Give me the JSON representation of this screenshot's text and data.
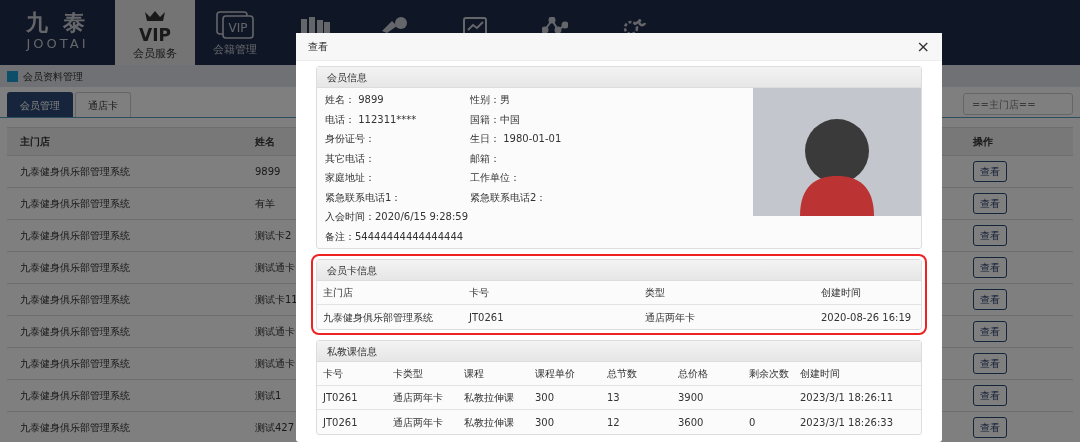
{
  "nav": {
    "logo_cn": "九 泰",
    "logo_en": "JOOTAI",
    "items": [
      {
        "kind": "crown",
        "icon_text": "VIP",
        "label": "会员服务",
        "selected": true
      },
      {
        "kind": "card",
        "icon_text": "VIP",
        "label": "会籍管理",
        "selected": false
      },
      {
        "kind": "books",
        "selected": false
      },
      {
        "kind": "tools",
        "selected": false
      },
      {
        "kind": "chart",
        "selected": false
      },
      {
        "kind": "network",
        "selected": false
      },
      {
        "kind": "gear",
        "selected": false
      }
    ]
  },
  "breadcrumb": "会员资料管理",
  "tabs": [
    {
      "label": "会员管理",
      "selected": true
    },
    {
      "label": "通店卡",
      "selected": false
    }
  ],
  "store_filter": {
    "value": "==主门店=="
  },
  "member_table": {
    "columns": [
      "主门店",
      "姓名",
      "操作"
    ],
    "rows": [
      {
        "store": "九泰健身俱乐部管理系统",
        "name": "9899",
        "action": "查看"
      },
      {
        "store": "九泰健身俱乐部管理系统",
        "name": "有羊",
        "action": "查看"
      },
      {
        "store": "九泰健身俱乐部管理系统",
        "name": "测试卡2",
        "action": "查看"
      },
      {
        "store": "九泰健身俱乐部管理系统",
        "name": "测试通卡",
        "action": "查看"
      },
      {
        "store": "九泰健身俱乐部管理系统",
        "name": "测试卡11",
        "action": "查看"
      },
      {
        "store": "九泰健身俱乐部管理系统",
        "name": "测试通卡",
        "action": "查看"
      },
      {
        "store": "九泰健身俱乐部管理系统",
        "name": "测试通卡",
        "action": "查看"
      },
      {
        "store": "九泰健身俱乐部管理系统",
        "name": "测试1",
        "action": "查看"
      },
      {
        "store": "九泰健身俱乐部管理系统",
        "name": "测试427",
        "action": "查看"
      }
    ]
  },
  "modal": {
    "title": "查看",
    "close": "×",
    "member_info": {
      "title": "会员信息",
      "rows": [
        [
          "姓名： 9899",
          "性别：男"
        ],
        [
          "电话： 112311****",
          "国籍：中国"
        ],
        [
          "身份证号：",
          "生日： 1980-01-01"
        ],
        [
          "其它电话：",
          "邮箱："
        ],
        [
          "家庭地址：",
          "工作单位："
        ],
        [
          "紧急联系电话1：",
          "紧急联系电话2："
        ],
        [
          "入会时间：2020/6/15 9:28:59"
        ],
        [
          "备注：54444444444444444"
        ]
      ]
    },
    "card_info": {
      "title": "会员卡信息",
      "highlighted": true,
      "columns": [
        "主门店",
        "卡号",
        "类型",
        "创建时间"
      ],
      "rows": [
        [
          "九泰健身俱乐部管理系统",
          "JT0261",
          "通店两年卡",
          "2020-08-26 16:19"
        ]
      ]
    },
    "private_lessons": {
      "title": "私教课信息",
      "columns": [
        "卡号",
        "卡类型",
        "课程",
        "课程单价",
        "总节数",
        "总价格",
        "剩余次数",
        "创建时间"
      ],
      "rows": [
        [
          "JT0261",
          "通店两年卡",
          "私教拉伸课",
          "300",
          "13",
          "3900",
          null,
          "2023/3/1 18:26:11"
        ],
        [
          "JT0261",
          "通店两年卡",
          "私教拉伸课",
          "300",
          "12",
          "3600",
          "0",
          "2023/3/1 18:26:33"
        ]
      ]
    }
  }
}
